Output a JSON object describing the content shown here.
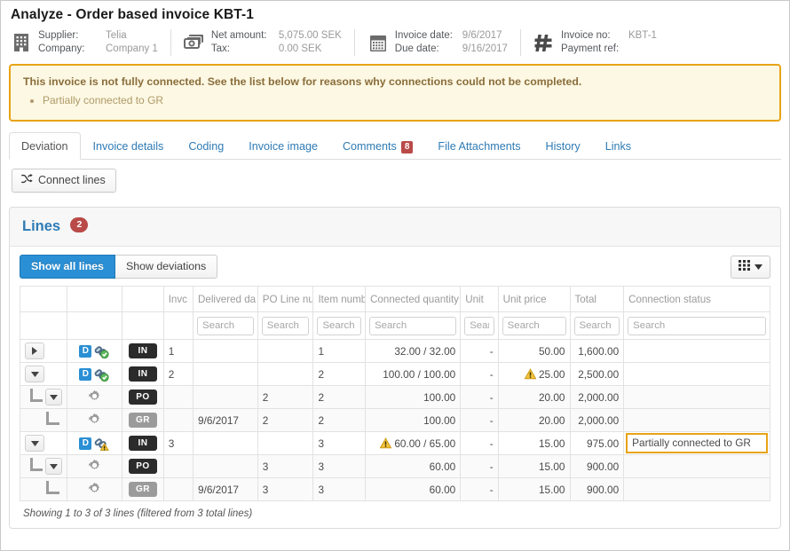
{
  "header": {
    "title": "Analyze - Order based invoice KBT-1",
    "info_groups": [
      {
        "icon": "building-icon",
        "rows": [
          {
            "label": "Supplier:",
            "value": "Telia"
          },
          {
            "label": "Company:",
            "value": "Company 1"
          }
        ]
      },
      {
        "icon": "money-icon",
        "rows": [
          {
            "label": "Net amount:",
            "value": "5,075.00 SEK"
          },
          {
            "label": "Tax:",
            "value": "0.00 SEK"
          }
        ]
      },
      {
        "icon": "calendar-icon",
        "rows": [
          {
            "label": "Invoice date:",
            "value": "9/6/2017"
          },
          {
            "label": "Due date:",
            "value": "9/16/2017"
          }
        ]
      },
      {
        "icon": "hash-icon",
        "rows": [
          {
            "label": "Invoice no:",
            "value": "KBT-1"
          },
          {
            "label": "Payment ref:",
            "value": ""
          }
        ]
      }
    ]
  },
  "alert": {
    "title": "This invoice is not fully connected. See the list below for reasons why connections could not be completed.",
    "items": [
      "Partially connected to GR"
    ],
    "border_color": "#e8a317",
    "bg_color": "#fcf8e3"
  },
  "tabs": [
    {
      "label": "Deviation",
      "active": true,
      "badge": ""
    },
    {
      "label": "Invoice details",
      "active": false,
      "badge": ""
    },
    {
      "label": "Coding",
      "active": false,
      "badge": ""
    },
    {
      "label": "Invoice image",
      "active": false,
      "badge": ""
    },
    {
      "label": "Comments",
      "active": false,
      "badge": "8"
    },
    {
      "label": "File Attachments",
      "active": false,
      "badge": ""
    },
    {
      "label": "History",
      "active": false,
      "badge": ""
    },
    {
      "label": "Links",
      "active": false,
      "badge": ""
    }
  ],
  "toolbar": {
    "connect_lines_label": "Connect lines",
    "connect_icon": "shuffle-icon"
  },
  "panel": {
    "title": "Lines",
    "count_badge": "2",
    "filters": {
      "show_all_label": "Show all lines",
      "show_deviations_label": "Show deviations",
      "active": "show_all"
    },
    "grid_button_icon": "grid-columns-icon"
  },
  "table": {
    "columns": [
      {
        "key": "toggle",
        "label": ""
      },
      {
        "key": "icons",
        "label": ""
      },
      {
        "key": "type",
        "label": ""
      },
      {
        "key": "invoice_line",
        "label": "Invc"
      },
      {
        "key": "delivered_date",
        "label": "Delivered da"
      },
      {
        "key": "po_line_no",
        "label": "PO Line nu"
      },
      {
        "key": "item_number",
        "label": "Item numb"
      },
      {
        "key": "connected_quantity",
        "label": "Connected quantity"
      },
      {
        "key": "unit",
        "label": "Unit"
      },
      {
        "key": "unit_price",
        "label": "Unit price"
      },
      {
        "key": "total",
        "label": "Total"
      },
      {
        "key": "connection_status",
        "label": "Connection status"
      }
    ],
    "search_placeholder": "Search",
    "search_columns": [
      "delivered_date",
      "po_line_no",
      "item_number",
      "connected_quantity",
      "unit",
      "unit_price",
      "total",
      "connection_status"
    ],
    "rows": [
      {
        "level": 0,
        "toggle": "collapsed",
        "icons": [
          "d-badge",
          "link-ok-icon"
        ],
        "type": "IN",
        "type_style": "in",
        "invoice_line": "1",
        "delivered_date": "",
        "po_line_no": "",
        "item_number": "1",
        "connected_quantity": "32.00  / 32.00",
        "quantity_warning": false,
        "unit": "-",
        "unit_price": "50.00",
        "unit_price_warning": false,
        "total": "1,600.00",
        "connection_status": "",
        "status_highlight": false
      },
      {
        "level": 0,
        "toggle": "expanded",
        "icons": [
          "d-badge",
          "link-ok-icon"
        ],
        "type": "IN",
        "type_style": "in",
        "invoice_line": "2",
        "delivered_date": "",
        "po_line_no": "",
        "item_number": "2",
        "connected_quantity": "100.00  / 100.00",
        "quantity_warning": false,
        "unit": "-",
        "unit_price": "25.00",
        "unit_price_warning": true,
        "total": "2,500.00",
        "connection_status": "",
        "status_highlight": false
      },
      {
        "level": 1,
        "toggle": "expanded",
        "icons": [
          "gear-icon"
        ],
        "type": "PO",
        "type_style": "po",
        "invoice_line": "",
        "delivered_date": "",
        "po_line_no": "2",
        "item_number": "2",
        "connected_quantity": "100.00",
        "quantity_warning": false,
        "unit": "-",
        "unit_price": "20.00",
        "unit_price_warning": false,
        "total": "2,000.00",
        "connection_status": "",
        "status_highlight": false
      },
      {
        "level": 2,
        "toggle": "none",
        "icons": [
          "gear-icon"
        ],
        "type": "GR",
        "type_style": "gr",
        "invoice_line": "",
        "delivered_date": "9/6/2017",
        "po_line_no": "2",
        "item_number": "2",
        "connected_quantity": "100.00",
        "quantity_warning": false,
        "unit": "-",
        "unit_price": "20.00",
        "unit_price_warning": false,
        "total": "2,000.00",
        "connection_status": "",
        "status_highlight": false
      },
      {
        "level": 0,
        "toggle": "expanded",
        "icons": [
          "d-badge",
          "link-warn-icon"
        ],
        "type": "IN",
        "type_style": "in",
        "invoice_line": "3",
        "delivered_date": "",
        "po_line_no": "",
        "item_number": "3",
        "connected_quantity": "60.00  / 65.00",
        "quantity_warning": true,
        "unit": "-",
        "unit_price": "15.00",
        "unit_price_warning": false,
        "total": "975.00",
        "connection_status": "Partially connected to GR",
        "status_highlight": true
      },
      {
        "level": 1,
        "toggle": "expanded",
        "icons": [
          "gear-icon"
        ],
        "type": "PO",
        "type_style": "po",
        "invoice_line": "",
        "delivered_date": "",
        "po_line_no": "3",
        "item_number": "3",
        "connected_quantity": "60.00",
        "quantity_warning": false,
        "unit": "-",
        "unit_price": "15.00",
        "unit_price_warning": false,
        "total": "900.00",
        "connection_status": "",
        "status_highlight": false
      },
      {
        "level": 2,
        "toggle": "none",
        "icons": [
          "gear-icon"
        ],
        "type": "GR",
        "type_style": "gr",
        "invoice_line": "",
        "delivered_date": "9/6/2017",
        "po_line_no": "3",
        "item_number": "3",
        "connected_quantity": "60.00",
        "quantity_warning": false,
        "unit": "-",
        "unit_price": "15.00",
        "unit_price_warning": false,
        "total": "900.00",
        "connection_status": "",
        "status_highlight": false
      }
    ],
    "footer": "Showing 1 to 3 of 3 lines (filtered from 3 total lines)"
  }
}
